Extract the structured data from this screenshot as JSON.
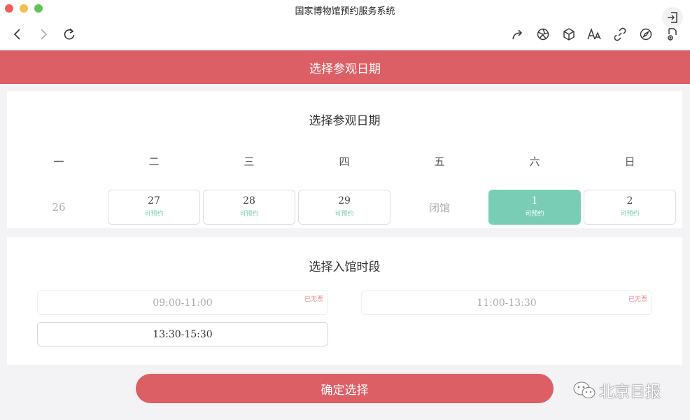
{
  "window": {
    "title": "国家博物馆预约服务系统"
  },
  "colors": {
    "brand": "#dc5f65",
    "available": "#7acdb5",
    "sold_out": "#e8888c"
  },
  "toolbar": {
    "nav": [
      "back-icon",
      "forward-icon",
      "reload-icon"
    ],
    "tools": [
      "share-icon",
      "aperture-icon",
      "cube-icon",
      "font-size-icon",
      "link-icon",
      "compass-icon",
      "document-settings-icon"
    ],
    "exit": "exit-icon"
  },
  "banner": {
    "title": "选择参观日期"
  },
  "date_section": {
    "title": "选择参观日期",
    "weekdays": [
      "一",
      "二",
      "三",
      "四",
      "五",
      "六",
      "日"
    ],
    "days": [
      {
        "label": "26",
        "status": ""
      },
      {
        "label": "27",
        "status": "可预约"
      },
      {
        "label": "28",
        "status": "可预约"
      },
      {
        "label": "29",
        "status": "可预约"
      },
      {
        "label": "闭馆",
        "status": ""
      },
      {
        "label": "1",
        "status": "可预约"
      },
      {
        "label": "2",
        "status": "可预约"
      }
    ]
  },
  "time_section": {
    "title": "选择入馆时段",
    "slots": [
      {
        "time": "09:00-11:00",
        "flag": "已无票"
      },
      {
        "time": "11:00-13:30",
        "flag": "已无票"
      },
      {
        "time": "13:30-15:30",
        "flag": ""
      }
    ]
  },
  "confirm": {
    "label": "确定选择"
  },
  "watermark": {
    "text": "北京日报"
  }
}
